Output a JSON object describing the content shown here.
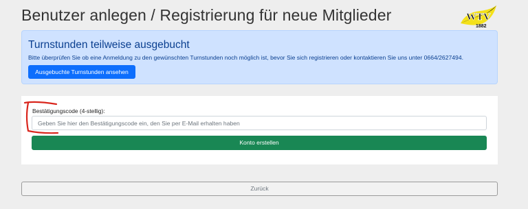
{
  "header": {
    "title": "Benutzer anlegen / Registrierung für neue Mitglieder",
    "logo_text": "WTV",
    "logo_year": "1882"
  },
  "alert": {
    "heading": "Turnstunden teilweise ausgebucht",
    "text": "Bitte überprüfen Sie ob eine Anmeldung zu den gewünschten Turnstunden noch möglich ist, bevor Sie sich registrieren oder kontaktieren Sie uns unter 0664/2627494.",
    "button_label": "Ausgebuchte Turnstunden ansehen"
  },
  "form": {
    "code_label": "Bestätigungscode (4-stellig):",
    "code_value": "",
    "code_placeholder": "Geben Sie hier den Bestätigungscode ein, den Sie per E-Mail erhalten haben",
    "submit_label": "Konto erstellen"
  },
  "footer": {
    "back_label": "Zurück"
  },
  "colors": {
    "alert_bg": "#cfe2ff",
    "primary": "#0d6efd",
    "success": "#198754",
    "annotation_red": "#d9251c",
    "logo_yellow": "#f4e11a"
  }
}
